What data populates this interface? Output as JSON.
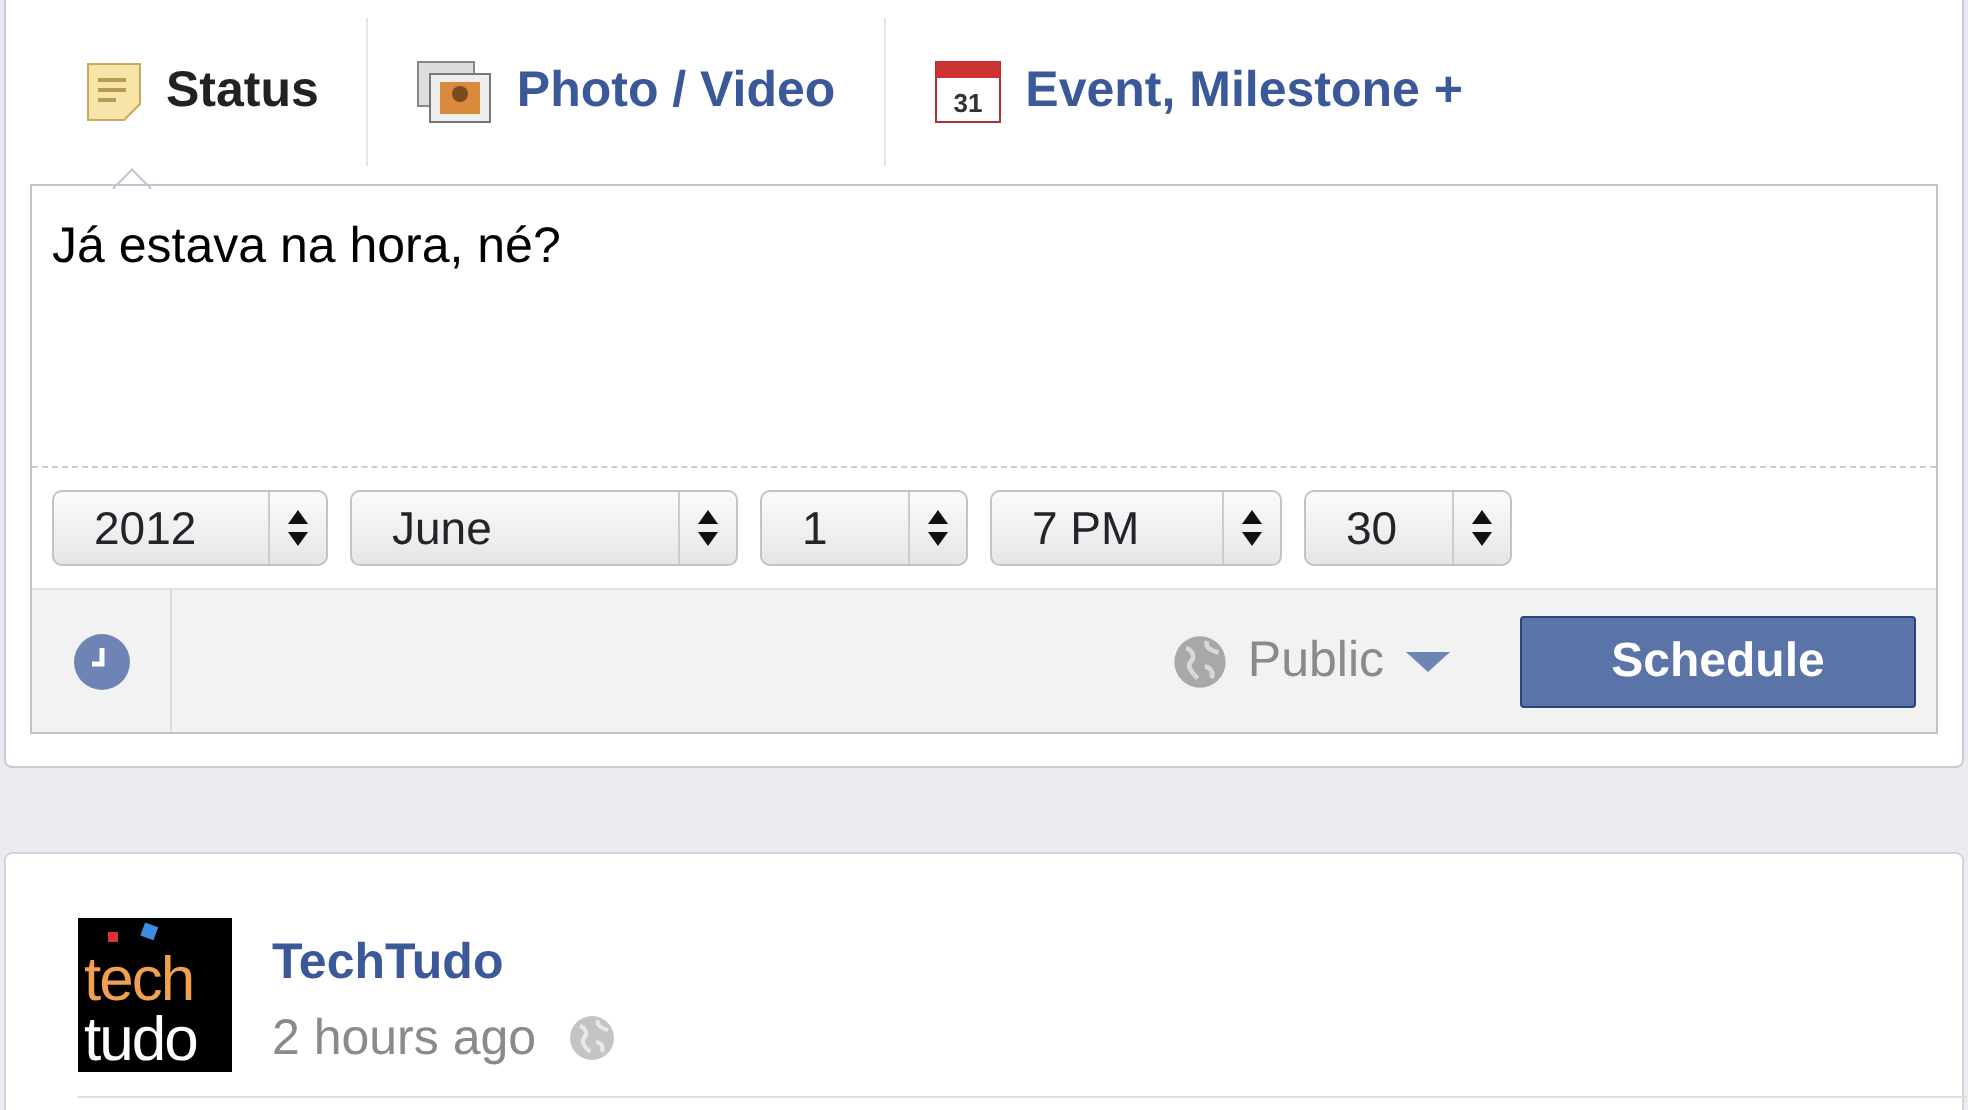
{
  "composer": {
    "tabs": [
      {
        "label": "Status",
        "kind": "note",
        "selected": true
      },
      {
        "label": "Photo / Video",
        "kind": "photo",
        "selected": false
      },
      {
        "label": "Event, Milestone +",
        "kind": "calendar",
        "icon_text": "31",
        "selected": false
      }
    ],
    "text": "Já estava na hora, né?",
    "date_selects": [
      {
        "value": "2012"
      },
      {
        "value": "June"
      },
      {
        "value": "1"
      },
      {
        "value": "7 PM"
      },
      {
        "value": "30"
      }
    ],
    "audience": "Public",
    "button": "Schedule"
  },
  "post": {
    "logo_lines": [
      "tech",
      "tudo"
    ],
    "author": "TechTudo",
    "time": "2 hours ago"
  }
}
